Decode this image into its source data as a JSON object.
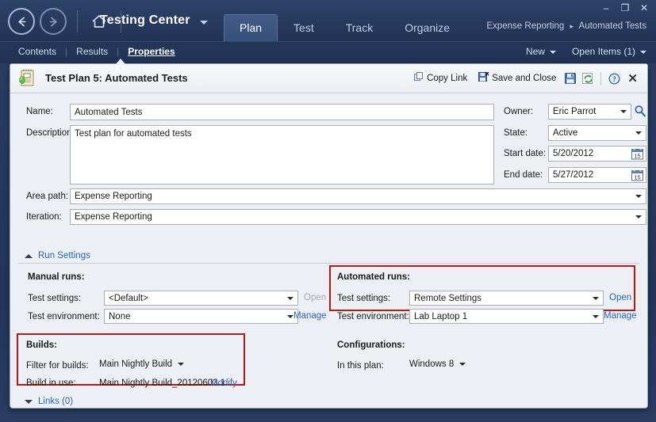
{
  "titlebar": {
    "back_icon": "arrow-left-circle",
    "forward_icon": "arrow-right-circle",
    "home_icon": "home",
    "app_title": "Testing Center",
    "tabs": [
      {
        "label": "Plan",
        "active": true
      },
      {
        "label": "Test",
        "active": false
      },
      {
        "label": "Track",
        "active": false
      },
      {
        "label": "Organize",
        "active": false
      }
    ],
    "breadcrumb": {
      "project": "Expense Reporting",
      "separator": "▸",
      "current": "Automated Tests"
    },
    "window_buttons": {
      "minimize": "–",
      "maximize": "❐",
      "close": "✕"
    }
  },
  "subnav": {
    "items": [
      {
        "label": "Contents",
        "active": false
      },
      {
        "label": "Results",
        "active": false
      },
      {
        "label": "Properties",
        "active": true
      }
    ],
    "divider": "|",
    "new_label": "New",
    "open_items_label": "Open Items (1)"
  },
  "form_header": {
    "icon": "test-plan-icon",
    "title": "Test Plan 5: Automated Tests",
    "copy_link_label": "Copy Link",
    "copy_link_icon": "copy-link-icon",
    "save_and_close_label": "Save and Close",
    "save_and_close_icon": "save-close-icon",
    "save_icon": "save-icon",
    "refresh_icon": "refresh-icon",
    "help_icon": "help-icon",
    "close_icon": "close-icon"
  },
  "fields": {
    "name": {
      "label": "Name:",
      "value": "Automated Tests"
    },
    "description": {
      "label": "Description:",
      "value": "Test plan for automated tests"
    },
    "area_path": {
      "label": "Area path:",
      "value": "Expense Reporting"
    },
    "iteration": {
      "label": "Iteration:",
      "value": "Expense Reporting"
    },
    "owner": {
      "label": "Owner:",
      "value": "Eric Parrot",
      "search_icon": "search-icon"
    },
    "state": {
      "label": "State:",
      "value": "Active"
    },
    "start_date": {
      "label": "Start date:",
      "value": "5/20/2012",
      "calendar_icon": "calendar-icon"
    },
    "end_date": {
      "label": "End date:",
      "value": "5/27/2012",
      "calendar_icon": "calendar-icon"
    }
  },
  "run_settings": {
    "section_label": "Run Settings",
    "chevron": "chevron-up-icon",
    "manual": {
      "title": "Manual runs:",
      "test_settings_label": "Test settings:",
      "test_settings_value": "<Default>",
      "test_settings_action": "Open",
      "test_settings_action_enabled": false,
      "test_environment_label": "Test environment:",
      "test_environment_value": "None",
      "test_environment_action": "Manage"
    },
    "automated": {
      "title": "Automated runs:",
      "test_settings_label": "Test settings:",
      "test_settings_value": "Remote Settings",
      "test_settings_action": "Open",
      "test_environment_label": "Test environment:",
      "test_environment_value": "Lab Laptop 1",
      "test_environment_action": "Manage"
    },
    "builds": {
      "title": "Builds:",
      "filter_label": "Filter for builds:",
      "filter_value": "Main Nightly Build",
      "build_in_use_label": "Build in use:",
      "build_in_use_value": "Main Nightly Build_20120603.1",
      "modify_label": "Modify"
    },
    "configurations": {
      "title": "Configurations:",
      "in_this_plan_label": "In this plan:",
      "in_this_plan_value": "Windows 8"
    }
  },
  "links_section": {
    "label": "Links (0)",
    "chevron": "chevron-down-icon"
  },
  "colors": {
    "chrome_blue": "#26395c",
    "accent_gold": "#e8c63a",
    "highlight_red": "#b01a1a",
    "link_blue": "#2c66b5",
    "panel_bg": "#eceff3"
  }
}
